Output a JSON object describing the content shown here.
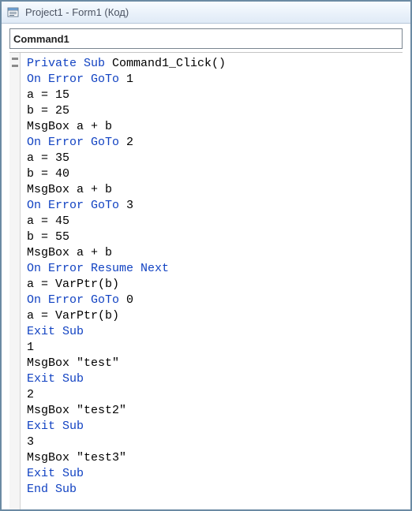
{
  "window": {
    "title": "Project1 - Form1 (Код)"
  },
  "dropdown": {
    "value": "Command1"
  },
  "code": {
    "lines": [
      [
        {
          "t": "kw",
          "v": "Private Sub"
        },
        {
          "t": "p",
          "v": " Command1_Click()"
        }
      ],
      [
        {
          "t": "kw",
          "v": "On Error GoTo"
        },
        {
          "t": "p",
          "v": " 1"
        }
      ],
      [
        {
          "t": "p",
          "v": "a = 15"
        }
      ],
      [
        {
          "t": "p",
          "v": "b = 25"
        }
      ],
      [
        {
          "t": "p",
          "v": "MsgBox a + b"
        }
      ],
      [
        {
          "t": "kw",
          "v": "On Error GoTo"
        },
        {
          "t": "p",
          "v": " 2"
        }
      ],
      [
        {
          "t": "p",
          "v": "a = 35"
        }
      ],
      [
        {
          "t": "p",
          "v": "b = 40"
        }
      ],
      [
        {
          "t": "p",
          "v": "MsgBox a + b"
        }
      ],
      [
        {
          "t": "kw",
          "v": "On Error GoTo"
        },
        {
          "t": "p",
          "v": " 3"
        }
      ],
      [
        {
          "t": "p",
          "v": "a = 45"
        }
      ],
      [
        {
          "t": "p",
          "v": "b = 55"
        }
      ],
      [
        {
          "t": "p",
          "v": "MsgBox a + b"
        }
      ],
      [
        {
          "t": "kw",
          "v": "On Error Resume Next"
        }
      ],
      [
        {
          "t": "p",
          "v": "a = VarPtr(b)"
        }
      ],
      [
        {
          "t": "kw",
          "v": "On Error GoTo"
        },
        {
          "t": "p",
          "v": " 0"
        }
      ],
      [
        {
          "t": "p",
          "v": "a = VarPtr(b)"
        }
      ],
      [
        {
          "t": "kw",
          "v": "Exit Sub"
        }
      ],
      [
        {
          "t": "p",
          "v": "1"
        }
      ],
      [
        {
          "t": "p",
          "v": "MsgBox \"test\""
        }
      ],
      [
        {
          "t": "kw",
          "v": "Exit Sub"
        }
      ],
      [
        {
          "t": "p",
          "v": "2"
        }
      ],
      [
        {
          "t": "p",
          "v": "MsgBox \"test2\""
        }
      ],
      [
        {
          "t": "kw",
          "v": "Exit Sub"
        }
      ],
      [
        {
          "t": "p",
          "v": "3"
        }
      ],
      [
        {
          "t": "p",
          "v": "MsgBox \"test3\""
        }
      ],
      [
        {
          "t": "kw",
          "v": "Exit Sub"
        }
      ],
      [
        {
          "t": "kw",
          "v": "End Sub"
        }
      ]
    ]
  }
}
